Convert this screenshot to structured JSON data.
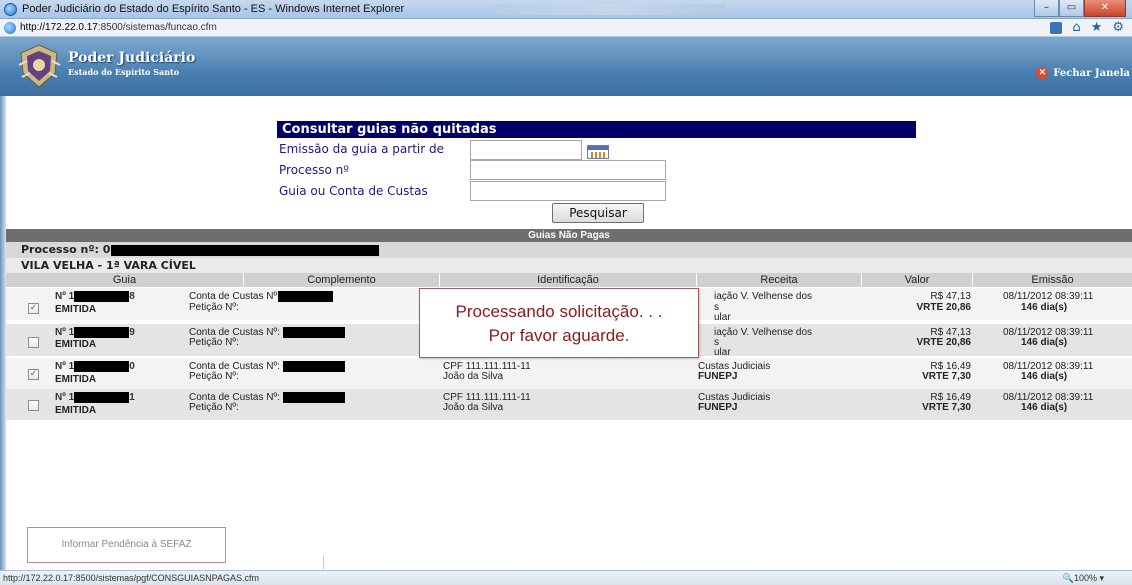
{
  "browser": {
    "title": "Poder Judiciário do Estado do Espírito Santo - ES - Windows Internet Explorer",
    "url_host": "http://172.22.0.17",
    "url_path": ":8500/sistemas/funcao.cfm",
    "status_url": "http://172.22.0.17:8500/sistemas/pgf/CONSGUIASNPAGAS.cfm",
    "zoom": "100%",
    "minimize": "–",
    "restore": "▭",
    "close": "✕"
  },
  "header": {
    "title": "Poder Judiciário",
    "subtitle": "Estado do Espírito Santo",
    "close_label": "Fechar Janela",
    "close_icon": "✕"
  },
  "form": {
    "title": "Consultar guias não quitadas",
    "emissao_label": "Emissão da guia a partir de",
    "processo_label": "Processo nº",
    "guia_label": "Guia ou Conta de Custas",
    "search_button": "Pesquisar"
  },
  "grid": {
    "title": "Guias Não Pagas",
    "processo_prefix": "Processo nº: 0",
    "vara": "VILA VELHA - 1ª VARA CÍVEL",
    "columns": [
      "Guia",
      "Complemento",
      "Identificação",
      "Receita",
      "Valor",
      "Emissão"
    ],
    "rows": [
      {
        "checked": "✓",
        "guia_prefix": "Nº 1",
        "guia_suffix": "8",
        "status": "EMITIDA",
        "conta_label": "Conta de Custas Nº",
        "peticao_label": "Petição Nº:",
        "ident1": "",
        "ident2": "",
        "receita1": "iação V. Velhense dos",
        "receita2": "s",
        "receita3": "ular",
        "valor1": "R$ 47,13",
        "valor2": "VRTE 20,86",
        "emissao1": "08/11/2012 08:39:11",
        "emissao2": "146 dia(s)"
      },
      {
        "checked": "",
        "guia_prefix": "Nº 1",
        "guia_suffix": "9",
        "status": "EMITIDA",
        "conta_label": "Conta de Custas Nº:",
        "peticao_label": "Petição Nº:",
        "ident1": "",
        "ident2": "",
        "receita1": "iação V. Velhense dos",
        "receita2": "s",
        "receita3": "ular",
        "valor1": "R$ 47,13",
        "valor2": "VRTE 20,86",
        "emissao1": "08/11/2012 08:39:11",
        "emissao2": "146 dia(s)"
      },
      {
        "checked": "✓",
        "guia_prefix": "Nº 1",
        "guia_suffix": "0",
        "status": "EMITIDA",
        "conta_label": "Conta de Custas Nº:",
        "peticao_label": "Petição Nº:",
        "ident1": "CPF 111.111.111-11",
        "ident2": "João da Silva",
        "receita1": "Custas Judiciais",
        "receita2": "FUNEPJ",
        "receita3": "",
        "valor1": "R$ 16,49",
        "valor2": "VRTE 7,30",
        "emissao1": "08/11/2012 08:39:11",
        "emissao2": "146 dia(s)"
      },
      {
        "checked": "",
        "guia_prefix": "Nº 1",
        "guia_suffix": "1",
        "status": "EMITIDA",
        "conta_label": "Conta de Custas Nº:",
        "peticao_label": "Petição Nº:",
        "ident1": "CPF 111.111.111-11",
        "ident2": "João da Silva",
        "receita1": "Custas Judiciais",
        "receita2": "FUNEPJ",
        "receita3": "",
        "valor1": "R$ 16,49",
        "valor2": "VRTE 7,30",
        "emissao1": "08/11/2012 08:39:11",
        "emissao2": "146 dia(s)"
      }
    ]
  },
  "overlay": {
    "line1": "Processando solicitação. . .",
    "line2": "Por favor aguarde."
  },
  "footer": {
    "sefaz_button": "Informar Pendência à SEFAZ"
  }
}
